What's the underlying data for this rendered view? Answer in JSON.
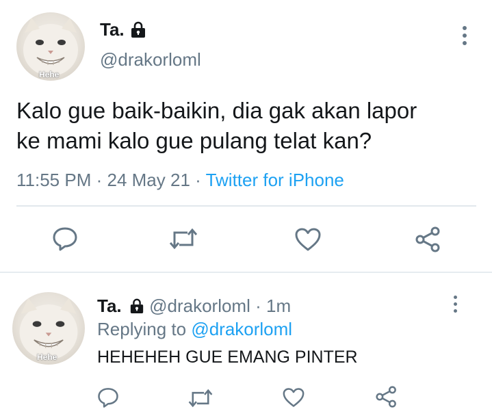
{
  "main_tweet": {
    "avatar_caption": "Hehe",
    "display_name": "Ta.",
    "handle": "@drakorloml",
    "text_line1": "Kalo gue baik-baikin, dia gak akan lapor",
    "text_line2": "ke mami kalo gue pulang telat kan?",
    "time": "11:55 PM",
    "date": "24 May 21",
    "sep": "·",
    "source": "Twitter for iPhone",
    "icons": {
      "reply": "reply-icon",
      "retweet": "retweet-icon",
      "like": "heart-icon",
      "share": "share-icon",
      "more": "more-options-icon",
      "lock": "lock-icon"
    }
  },
  "reply_tweet": {
    "avatar_caption": "Hehe",
    "display_name": "Ta.",
    "handle": "@drakorloml",
    "sep": "·",
    "time_ago": "1m",
    "replying_prefix": "Replying to",
    "replying_handle": "@drakorloml",
    "text": "HEHEHEH GUE EMANG PINTER"
  },
  "colors": {
    "accent": "#1da1f2",
    "muted": "#657786",
    "text": "#14171a",
    "divider": "#e1e8ed"
  }
}
